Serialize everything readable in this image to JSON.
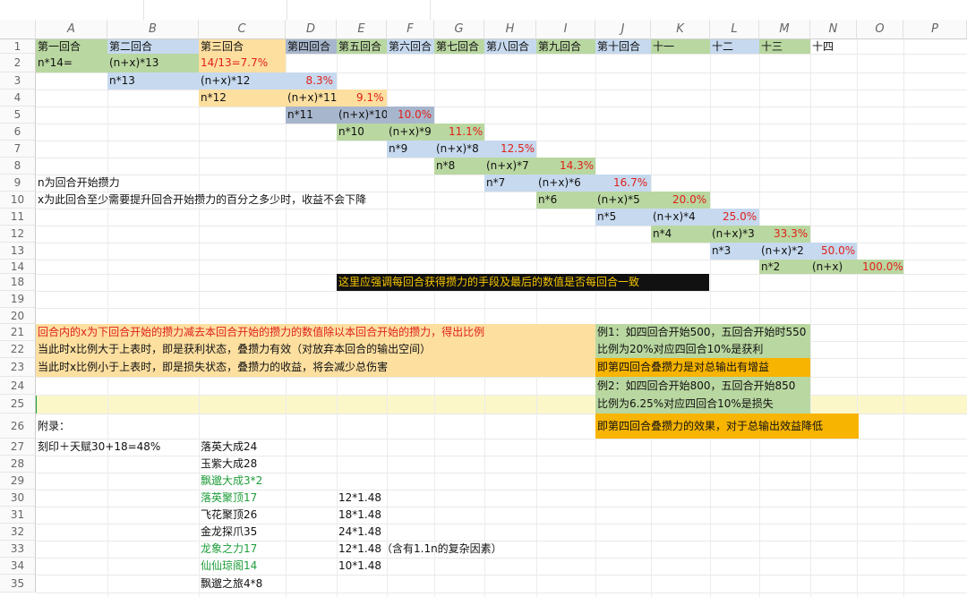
{
  "columns": [
    "A",
    "B",
    "C",
    "D",
    "E",
    "F",
    "G",
    "H",
    "I",
    "J",
    "K",
    "L",
    "M",
    "N",
    "O",
    "P"
  ],
  "rows": [
    "1",
    "2",
    "3",
    "4",
    "5",
    "6",
    "7",
    "8",
    "9",
    "10",
    "11",
    "12",
    "13",
    "14",
    "18",
    "19",
    "20",
    "21",
    "22",
    "23",
    "24",
    "25",
    "26",
    "27",
    "28",
    "29",
    "30",
    "31",
    "32",
    "33",
    "34",
    "35"
  ],
  "r1": [
    "第一回合",
    "第二回合",
    "第三回合",
    "第四回合",
    "第五回合",
    "第六回合",
    "第七回合",
    "第八回合",
    "第九回合",
    "第十回合",
    "十一",
    "十二",
    "十三",
    "十四"
  ],
  "r2": {
    "a": "n*14=",
    "b": "(n+x)*13",
    "c": "14/13=7.7%"
  },
  "r3": {
    "b": "n*13",
    "c": "(n+x)*12",
    "d": "8.3%"
  },
  "r4": {
    "c": "n*12",
    "d": "(n+x)*11",
    "e": "9.1%"
  },
  "r5": {
    "d": "n*11",
    "e": "(n+x)*10",
    "f": "10.0%"
  },
  "r6": {
    "e": "n*10",
    "f": "(n+x)*9",
    "g": "11.1%"
  },
  "r7": {
    "f": "n*9",
    "g": "(n+x)*8",
    "h": "12.5%"
  },
  "r8": {
    "g": "n*8",
    "h": "(n+x)*7",
    "i": "14.3%"
  },
  "r9": {
    "a": "n为回合开始攒力",
    "h": "n*7",
    "i": "(n+x)*6",
    "j": "16.7%"
  },
  "r10": {
    "a": "x为此回合至少需要提升回合开始攒力的百分之多少时，收益不会下降",
    "i": "n*6",
    "j": "(n+x)*5",
    "k": "20.0%"
  },
  "r11": {
    "j": "n*5",
    "k": "(n+x)*4",
    "l": "25.0%"
  },
  "r12": {
    "k": "n*4",
    "l": "(n+x)*3",
    "m": "33.3%"
  },
  "r13": {
    "l": "n*3",
    "m": "(n+x)*2",
    "n": "50.0%"
  },
  "r14": {
    "m": "n*2",
    "n": "(n+x)",
    "o": "100.0%"
  },
  "r18": "这里应强调每回合获得攒力的手段及最后的数值是否每回合一致",
  "r21": {
    "a": "回合内的x为下回合开始的攒力减去本回合开始的攒力的数值除以本回合开始的攒力，得出比例",
    "j": "例1：如四回合开始500，五回合开始时550"
  },
  "r22": {
    "a": "当此时x比例大于上表时，即是获利状态，叠攒力有效（对放弃本回合的输出空间）",
    "j": "比例为20%对应四回合10%是获利"
  },
  "r23": {
    "a": "当此时x比例小于上表时，即是损失状态，叠攒力的收益，将会减少总伤害",
    "j": "即第四回合叠攒力是对总输出有增益"
  },
  "r24": {
    "j": "例2：如四回合开始800，五回合开始850"
  },
  "r25": {
    "j": "比例为6.25%对应四回合10%是损失"
  },
  "r26": {
    "a": "附录：",
    "j": "即第四回合叠攒力的效果，对于总输出效益降低"
  },
  "r27": {
    "a": "刻印＋天赋30+18=48%",
    "c": "落英大成24"
  },
  "r28": {
    "c": "玉紫大成28"
  },
  "r29": {
    "c": "飘邈大成3*2"
  },
  "r30": {
    "c": "落英聚顶17",
    "e": "12*1.48"
  },
  "r31": {
    "c": "飞花聚顶26",
    "e": "18*1.48"
  },
  "r32": {
    "c": "金龙探爪35",
    "e": "24*1.48"
  },
  "r33": {
    "c": "龙象之力17",
    "e": "12*1.48（含有1.1n的复杂因素）"
  },
  "r34": {
    "c": "仙仙琼阁14",
    "e": "10*1.48"
  },
  "r35": {
    "c": "飘邈之旅4*8"
  },
  "colors": {
    "green": "#b9d7a0",
    "blue": "#c6d9ef",
    "yellow": "#fddfa0",
    "slate": "#a7b6cc",
    "orange": "#f7b400",
    "red": "#e0201a",
    "textGreen": "#1f9d3a"
  }
}
